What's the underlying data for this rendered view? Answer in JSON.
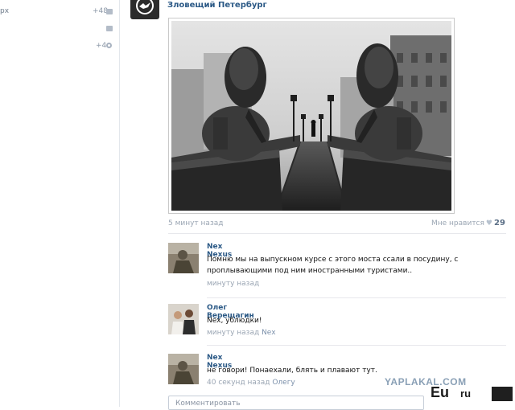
{
  "left": {
    "partial_label": "рх",
    "count_top": "48",
    "count_mid": "4"
  },
  "post": {
    "group_name": "Зловещий Петербург",
    "time": "5 минут назад",
    "like_label": "Мне нравится",
    "like_count": "29"
  },
  "comments": [
    {
      "author": "Nex Nexus",
      "text": "Помню мы на выпускном курсе с этого моста ссали в посудину, с проплывающими под ним иностранными туристами..",
      "time": "минуту назад",
      "reply_to": ""
    },
    {
      "author": "Олег Верещагин",
      "text": "Nex, ублюдки!",
      "time": "минуту назад",
      "reply_to": "Nex"
    },
    {
      "author": "Nex Nexus",
      "text": "не говори! Понаехали, блять и плавают тут.",
      "time": "40 секунд назад",
      "reply_to": "Олегу"
    }
  ],
  "comment_input": {
    "placeholder": "Комментировать"
  },
  "watermark": {
    "line1": "YAPLAKAL.COM",
    "line2": "Eu",
    "suffix": "ru"
  },
  "icons": [
    "camera-icon",
    "message-icon",
    "gear-icon",
    "heart-icon"
  ]
}
